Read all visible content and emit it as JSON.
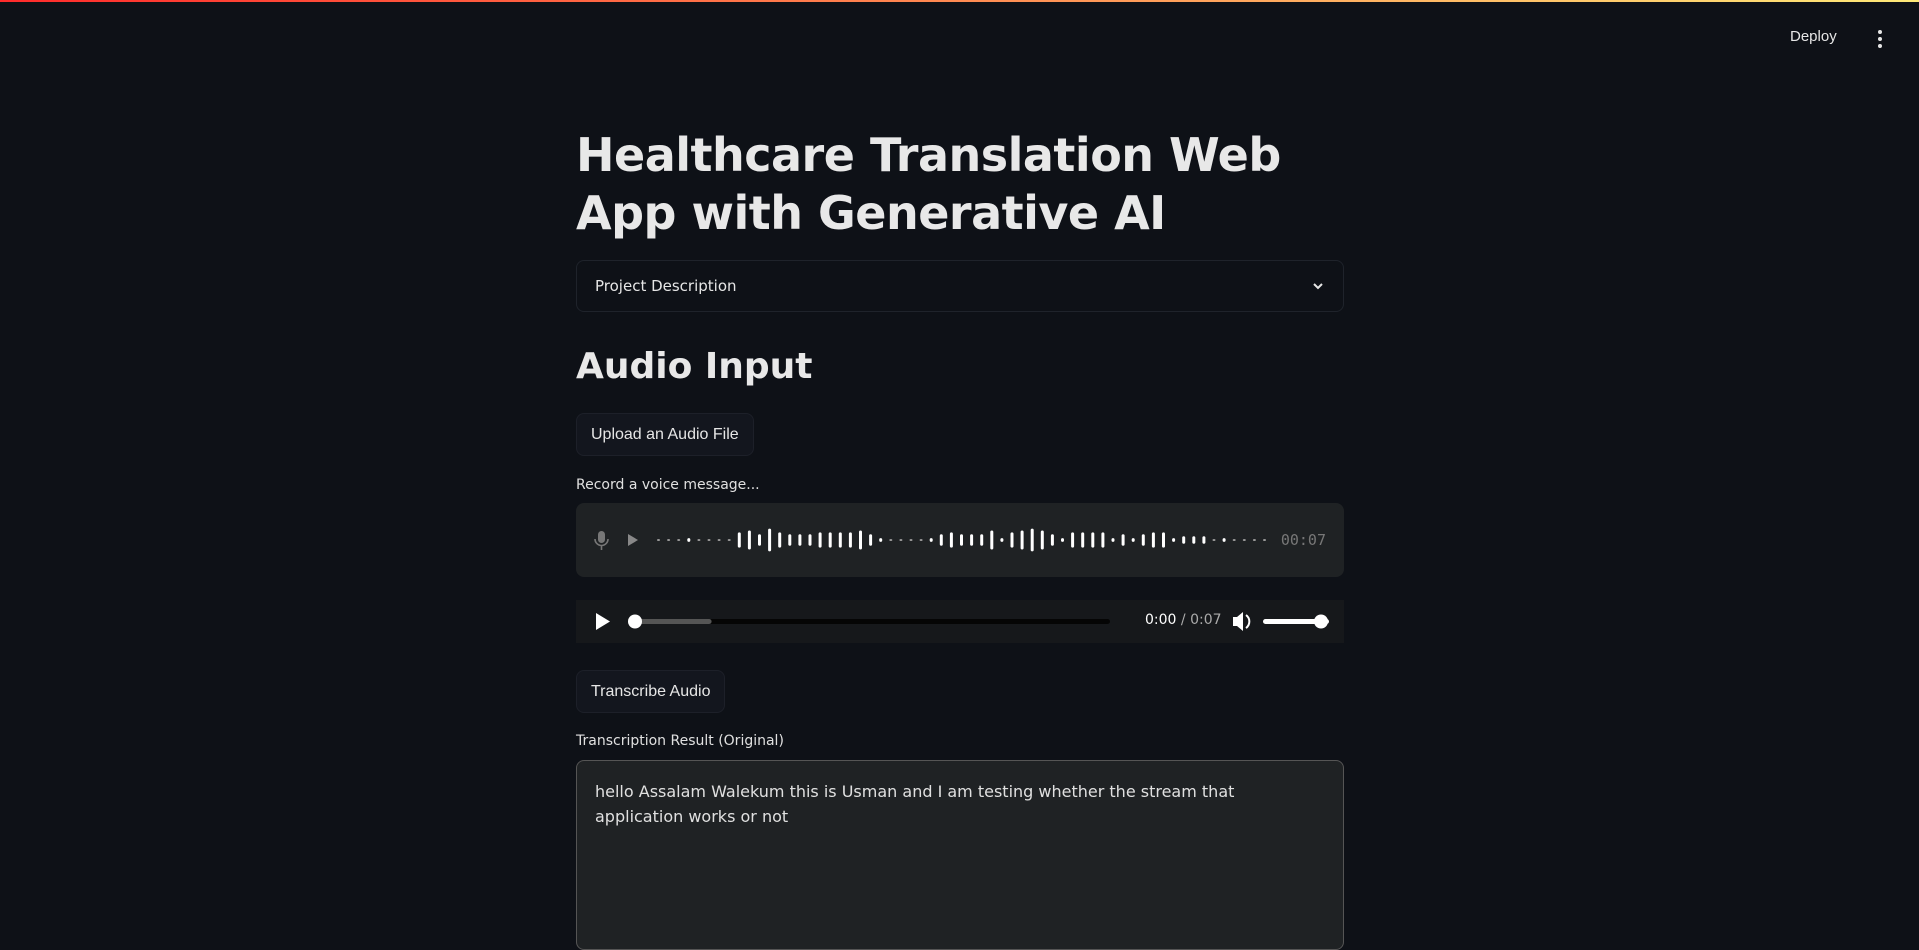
{
  "header": {
    "deploy_label": "Deploy",
    "menu_icon": "more-vertical-icon"
  },
  "title": "Healthcare Translation Web App with Generative AI",
  "expander": {
    "label": "Project Description",
    "icon": "chevron-down-icon"
  },
  "audio_section": {
    "heading": "Audio Input",
    "upload_button": "Upload an Audio File",
    "recorder_label": "Record a voice message...",
    "recorder_time": "00:07",
    "player": {
      "current": "0:00",
      "separator": "/",
      "duration": "0:07",
      "progress_fraction": 0,
      "buffered_fraction": 0.17,
      "volume": 1.0
    }
  },
  "transcribe_button": "Transcribe Audio",
  "transcription": {
    "label": "Transcription Result (Original)",
    "value": "hello Assalam Walekum this is Usman and I am testing whether the stream that application works or not"
  }
}
